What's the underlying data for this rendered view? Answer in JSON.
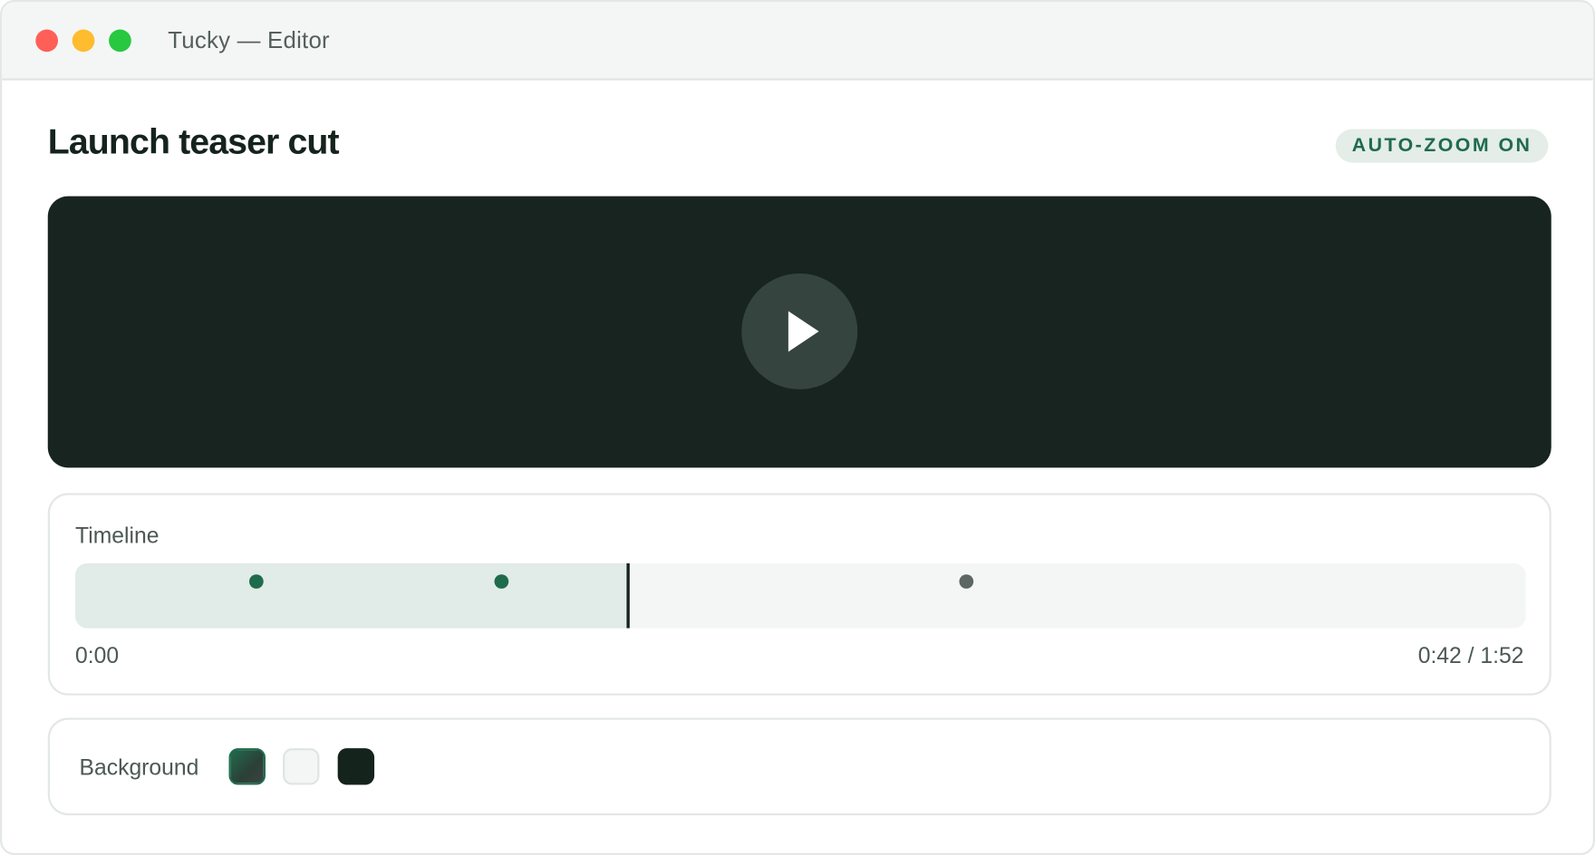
{
  "window": {
    "title": "Tucky — Editor"
  },
  "editor": {
    "title": "Launch teaser cut",
    "badge": "AUTO-ZOOM ON"
  },
  "player": {
    "play_icon": "play-icon"
  },
  "timeline": {
    "label": "Timeline",
    "start_time": "0:00",
    "current_time": "0:42 / 1:52",
    "progress_percent": 38.1,
    "markers": [
      {
        "position_percent": 12.5,
        "color": "#1f6b4d"
      },
      {
        "position_percent": 29.4,
        "color": "#1f6b4d"
      },
      {
        "position_percent": 61.4,
        "color": "#5d6663"
      }
    ]
  },
  "background": {
    "label": "Background",
    "swatches": [
      {
        "name": "gradient",
        "color": "#1f6b4d"
      },
      {
        "name": "light",
        "color": "#f4f6f5"
      },
      {
        "name": "dark",
        "color": "#15231d"
      }
    ]
  },
  "colors": {
    "accent": "#1f6b4d",
    "dark": "#172420"
  }
}
